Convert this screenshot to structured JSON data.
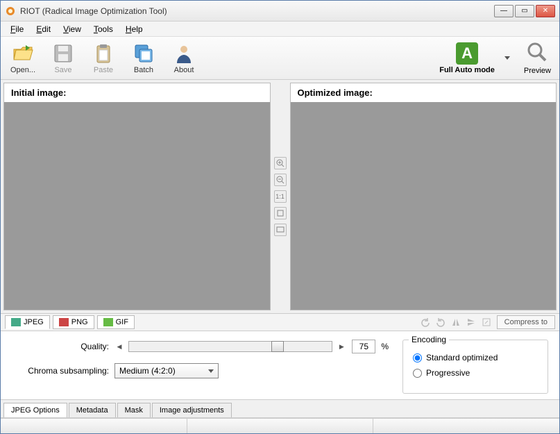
{
  "window": {
    "title": "RIOT (Radical Image Optimization Tool)"
  },
  "menu": {
    "file": "File",
    "edit": "Edit",
    "view": "View",
    "tools": "Tools",
    "help": "Help"
  },
  "toolbar": {
    "open": "Open...",
    "save": "Save",
    "paste": "Paste",
    "batch": "Batch",
    "about": "About",
    "auto_mode": "Full Auto mode",
    "preview": "Preview"
  },
  "panels": {
    "initial": "Initial image:",
    "optimized": "Optimized image:"
  },
  "center_tools": {
    "one_to_one": "1:1"
  },
  "format_tabs": {
    "jpeg": "JPEG",
    "png": "PNG",
    "gif": "GIF"
  },
  "compress_label": "Compress to",
  "options": {
    "quality_label": "Quality:",
    "quality_value": "75",
    "quality_pct": "%",
    "chroma_label": "Chroma subsampling:",
    "chroma_value": "Medium (4:2:0)"
  },
  "encoding": {
    "legend": "Encoding",
    "standard": "Standard optimized",
    "progressive": "Progressive"
  },
  "bottom_tabs": {
    "jpeg_options": "JPEG Options",
    "metadata": "Metadata",
    "mask": "Mask",
    "image_adjustments": "Image adjustments"
  }
}
